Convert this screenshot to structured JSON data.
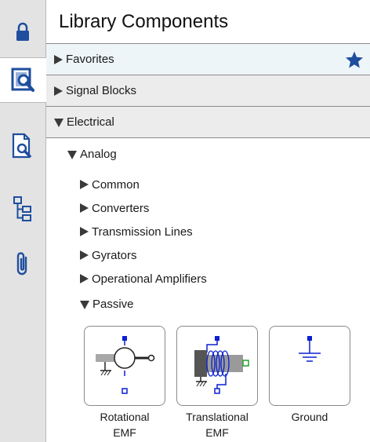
{
  "panel": {
    "title": "Library Components"
  },
  "rail": {
    "buttons": [
      {
        "icon": "lock-icon"
      },
      {
        "icon": "library-icon",
        "active": true
      },
      {
        "icon": "document-search-icon"
      },
      {
        "icon": "hierarchy-icon"
      },
      {
        "icon": "paperclip-icon"
      }
    ]
  },
  "sections": {
    "favorites": "Favorites",
    "signal_blocks": "Signal Blocks",
    "electrical": "Electrical"
  },
  "tree": {
    "analog": "Analog",
    "items": [
      "Common",
      "Converters",
      "Transmission Lines",
      "Gyrators",
      "Operational Amplifiers"
    ],
    "passive": "Passive"
  },
  "components": [
    {
      "line1": "Rotational",
      "line2": "EMF"
    },
    {
      "line1": "Translational",
      "line2": "EMF"
    },
    {
      "line1": "Ground",
      "line2": ""
    }
  ],
  "colors": {
    "accent_blue": "#1f4e9e",
    "port_blue": "#0b1fd1",
    "port_green": "#22a02a",
    "favorites_bg": "#eef5f8"
  }
}
